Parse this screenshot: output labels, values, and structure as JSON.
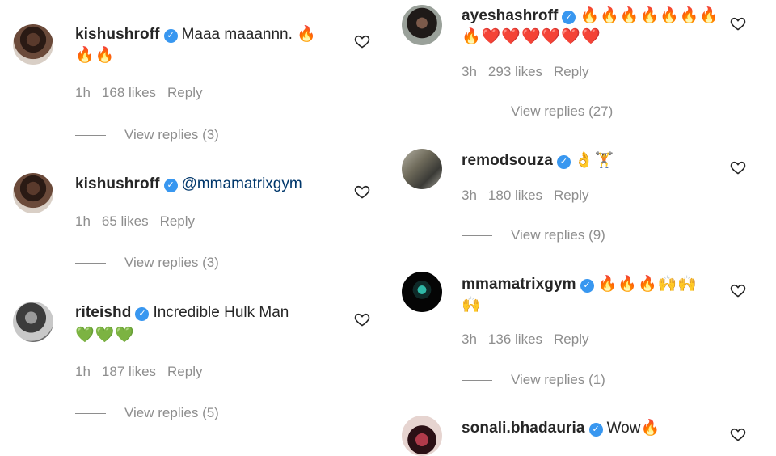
{
  "comments": [
    {
      "username": "kishushroff",
      "text": "Maaa maaannn. ",
      "emoji_inline": "🔥",
      "emoji_line2": "🔥🔥",
      "time": "1h",
      "likes": "168 likes",
      "reply": "Reply",
      "view_replies": "View replies (3)"
    },
    {
      "username": "kishushroff",
      "mention": "@mmamatrixgym",
      "time": "1h",
      "likes": "65 likes",
      "reply": "Reply",
      "view_replies": "View replies (3)"
    },
    {
      "username": "riteishd",
      "text": "Incredible Hulk Man",
      "emoji_line2": "💚💚💚",
      "time": "1h",
      "likes": "187 likes",
      "reply": "Reply",
      "view_replies": "View replies (5)"
    },
    {
      "username": "ayeshashroff",
      "emoji_inline": "🔥🔥🔥🔥🔥🔥🔥",
      "emoji_line2": "🔥❤️❤️❤️❤️❤️❤️",
      "time": "3h",
      "likes": "293 likes",
      "reply": "Reply",
      "view_replies": "View replies (27)"
    },
    {
      "username": "remodsouza",
      "emoji_inline": "👌🏋",
      "time": "3h",
      "likes": "180 likes",
      "reply": "Reply",
      "view_replies": "View replies (9)"
    },
    {
      "username": "mmamatrixgym",
      "emoji_inline": "🔥🔥🔥🙌🙌",
      "emoji_line2": "🙌",
      "time": "3h",
      "likes": "136 likes",
      "reply": "Reply",
      "view_replies": "View replies (1)"
    },
    {
      "username": "sonali.bhadauria",
      "text": "Wow",
      "emoji_inline": "🔥"
    }
  ],
  "verified_mark": "✓",
  "colors": {
    "verified": "#3897f0",
    "mention": "#00376b",
    "meta": "#8e8e8e"
  }
}
